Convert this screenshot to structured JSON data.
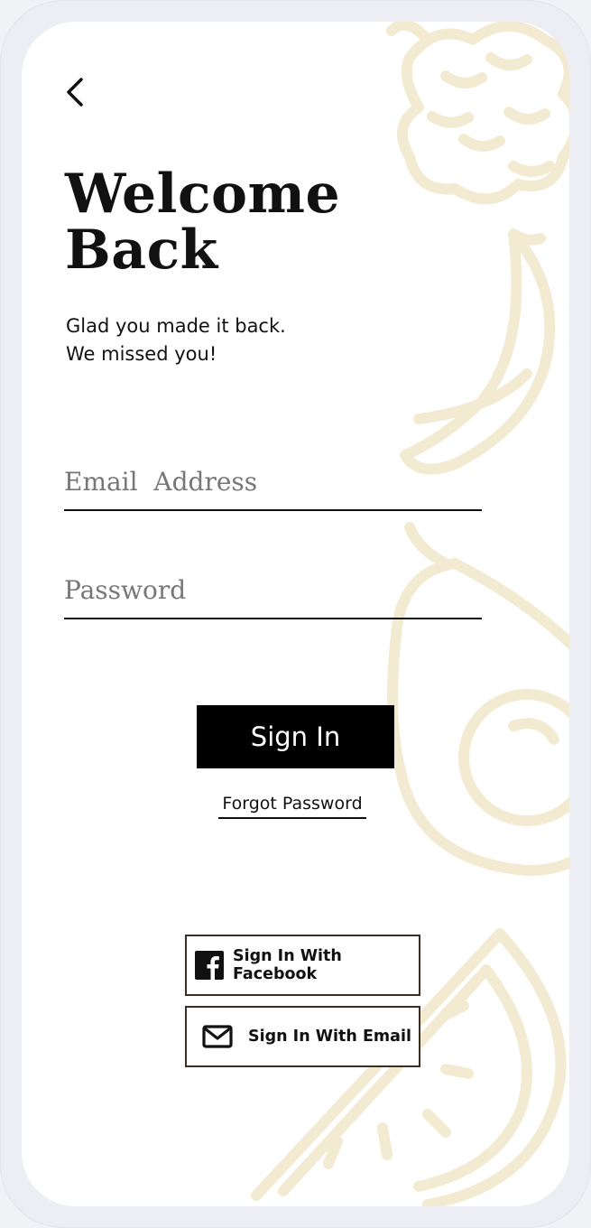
{
  "header": {
    "back_icon": "chevron-left-icon"
  },
  "welcome": {
    "title_line1": "Welcome",
    "title_line2": "Back",
    "subtitle_line1": "Glad you made it back.",
    "subtitle_line2": "We missed you!"
  },
  "form": {
    "email_placeholder": "Email  Address",
    "email_value": "",
    "password_placeholder": "Password",
    "password_value": "",
    "signin_label": "Sign In",
    "forgot_label": "Forgot Password"
  },
  "social": {
    "facebook_label": "Sign In With Facebook",
    "facebook_icon": "facebook-icon",
    "email_label": "Sign In With Email",
    "email_icon": "envelope-icon"
  },
  "colors": {
    "primary": "#000000",
    "background": "#ffffff",
    "decoration": "#f3ead2",
    "social_border": "#3a2e26"
  }
}
